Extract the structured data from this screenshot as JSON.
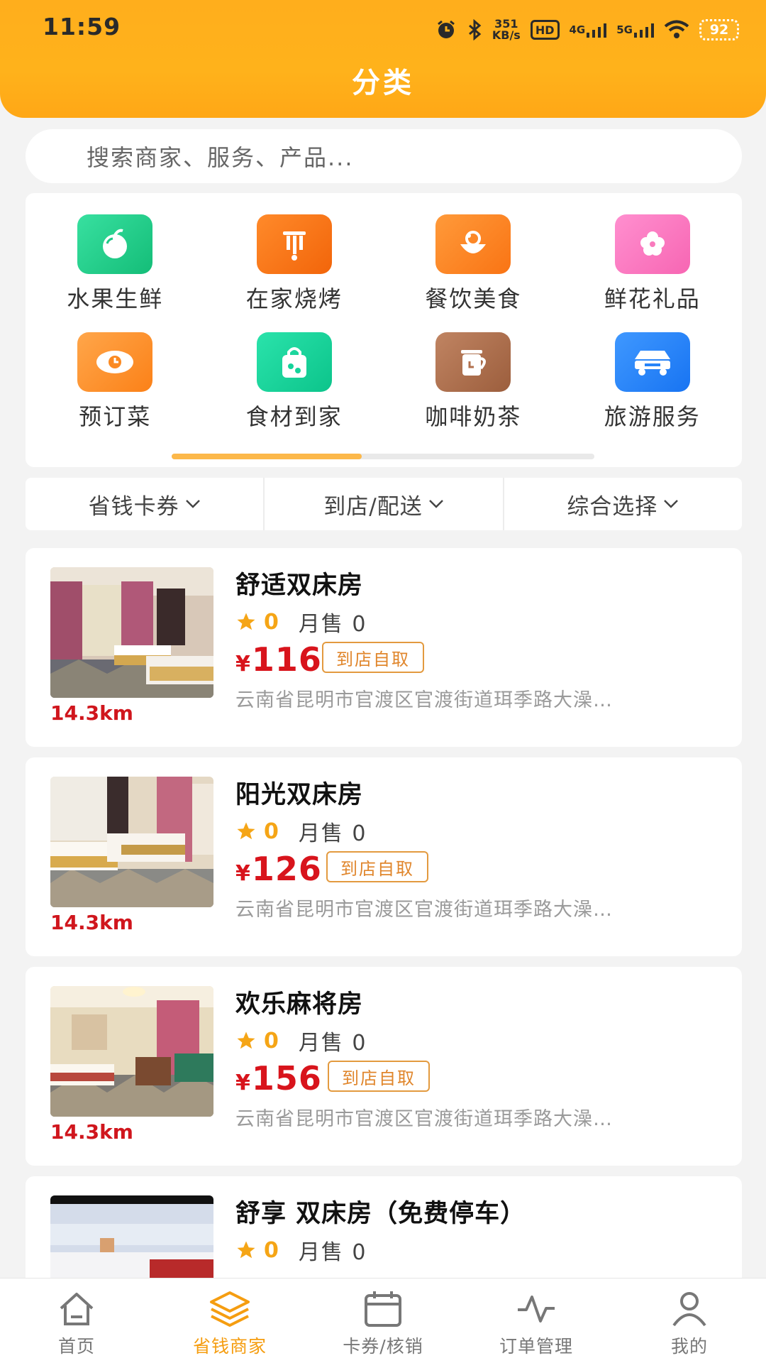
{
  "status_bar": {
    "time": "11:59",
    "net_speed_value": "351",
    "net_speed_unit": "KB/s",
    "hd_badge": "HD",
    "signal_1": "4G",
    "signal_2": "5G",
    "battery": "92",
    "icons": [
      "alarm-icon",
      "bluetooth-icon",
      "wifi-icon",
      "battery-icon"
    ]
  },
  "header": {
    "title": "分类"
  },
  "search": {
    "placeholder": "搜索商家、服务、产品..."
  },
  "categories": [
    {
      "label": "水果生鲜",
      "icon": "fruit-icon",
      "color": "#1ec987"
    },
    {
      "label": "在家烧烤",
      "icon": "bbq-icon",
      "color": "#fb7312"
    },
    {
      "label": "餐饮美食",
      "icon": "dining-icon",
      "color": "#fc8420"
    },
    {
      "label": "鲜花礼品",
      "icon": "flower-icon",
      "color": "#fd78c0"
    },
    {
      "label": "预订菜",
      "icon": "reserve-dish-icon",
      "color": "#fd912e"
    },
    {
      "label": "食材到家",
      "icon": "grocery-bag-icon",
      "color": "#14d39a"
    },
    {
      "label": "咖啡奶茶",
      "icon": "coffee-icon",
      "color": "#b2714e"
    },
    {
      "label": "旅游服务",
      "icon": "travel-icon",
      "color": "#2784f8"
    }
  ],
  "category_scroll": {
    "position_fraction": 0.45
  },
  "filters": [
    {
      "label": "省钱卡券"
    },
    {
      "label": "到店/配送"
    },
    {
      "label": "综合选择"
    }
  ],
  "products": [
    {
      "title": "舒适双床房",
      "rating": "0",
      "sold": "月售 0",
      "currency": "¥",
      "price": "116",
      "tag": "到店自取",
      "address": "云南省昆明市官渡区官渡街道珥季路大澡…",
      "distance": "14.3km"
    },
    {
      "title": "阳光双床房",
      "rating": "0",
      "sold": "月售 0",
      "currency": "¥",
      "price": "126",
      "tag": "到店自取",
      "address": "云南省昆明市官渡区官渡街道珥季路大澡…",
      "distance": "14.3km"
    },
    {
      "title": "欢乐麻将房",
      "rating": "0",
      "sold": "月售 0",
      "currency": "¥",
      "price": "156",
      "tag": "到店自取",
      "address": "云南省昆明市官渡区官渡街道珥季路大澡…",
      "distance": "14.3km"
    },
    {
      "title": "舒享 双床房（免费停车）",
      "rating": "0",
      "sold": "月售 0"
    }
  ],
  "bottom_nav": [
    {
      "label": "首页",
      "icon": "home-icon",
      "active": false
    },
    {
      "label": "省钱商家",
      "icon": "layers-icon",
      "active": true
    },
    {
      "label": "卡券/核销",
      "icon": "calendar-icon",
      "active": false
    },
    {
      "label": "订单管理",
      "icon": "activity-icon",
      "active": false
    },
    {
      "label": "我的",
      "icon": "user-icon",
      "active": false
    }
  ],
  "colors": {
    "brand": "#ffac1a",
    "price": "#d8141c",
    "rating": "#f5a516",
    "active_nav": "#f59d10"
  }
}
